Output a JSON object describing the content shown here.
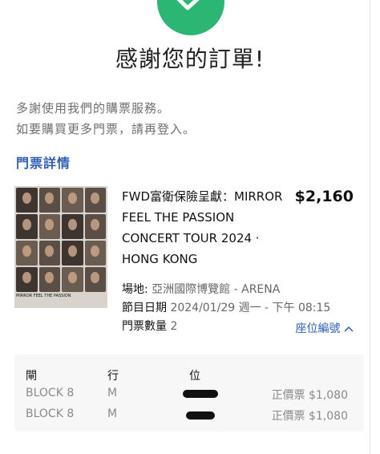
{
  "header": {
    "title": "感謝您的訂單!",
    "intro_line1": "多謝使用我們的購票服務。",
    "intro_line2": "如要購買更多門票，請再登入。",
    "section_title": "門票詳情"
  },
  "event": {
    "name": "FWD富衛保險呈獻：MIRROR\nFEEL THE PASSION\nCONCERT TOUR 2024 ·\nHONG KONG",
    "price": "$2,160",
    "venue_label": "場地:",
    "venue_value": "亞洲國際博覽館 - ARENA",
    "date_label": "節目日期",
    "date_value": "2024/01/29 週一 - 下午 08:15",
    "qty_label": "門票數量",
    "qty_value": "2",
    "seat_link": "座位編號",
    "poster_footer": "MIRROR FEEL THE PASSION"
  },
  "seats": {
    "headers": {
      "gate": "閘",
      "row": "行",
      "seat": "位"
    },
    "rows": [
      {
        "gate": "BLOCK 8",
        "row": "M",
        "price": "正價票 $1,080"
      },
      {
        "gate": "BLOCK 8",
        "row": "M",
        "price": "正價票 $1,080"
      }
    ]
  },
  "colors": {
    "accent": "#2f5fb3",
    "success": "#2bb673"
  }
}
